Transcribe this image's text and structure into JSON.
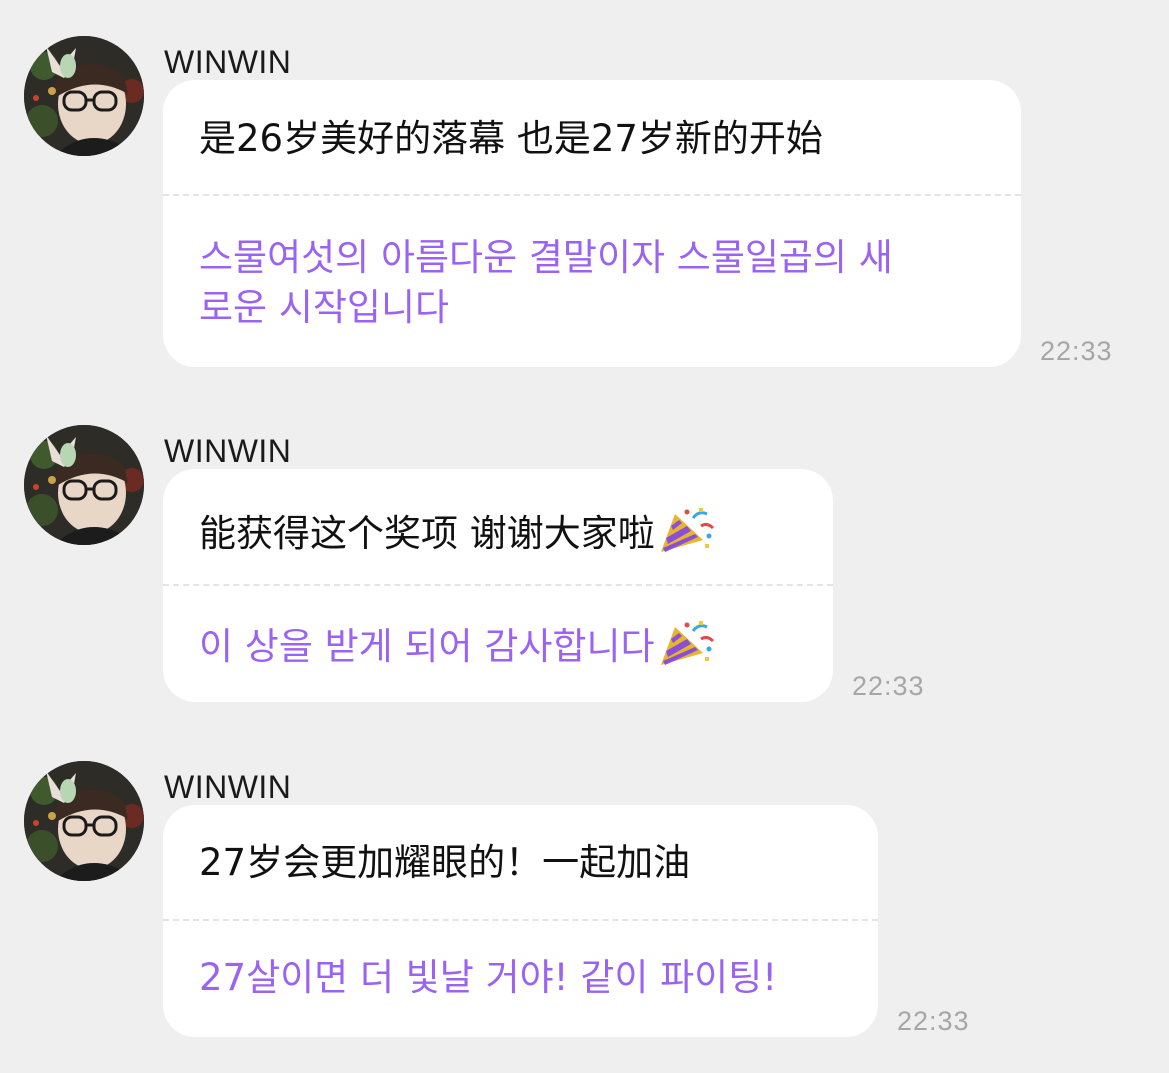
{
  "messages": [
    {
      "sender": "WINWIN",
      "zh": "是26岁美好的落幕 也是27岁新的开始",
      "ko_line1": "스물여섯의 아름다운 결말이자 스물일곱의 새",
      "ko_line2": "로운 시작입니다",
      "time": "22:33"
    },
    {
      "sender": "WINWIN",
      "zh": "能获得这个奖项 谢谢大家啦",
      "zh_emoji": "party-popper-icon",
      "ko_line1": "이 상을 받게 되어 감사합니다",
      "ko_emoji": "party-popper-icon",
      "time": "22:33"
    },
    {
      "sender": "WINWIN",
      "zh": " 27岁会更加耀眼的！一起加油",
      "ko_line1": "27살이면 더 빛날 거야! 같이 파이팅!",
      "time": "22:33"
    }
  ],
  "colors": {
    "background": "#efefef",
    "bubble": "#ffffff",
    "translation_text": "#9b63f2",
    "timestamp": "#a6a6a6"
  }
}
